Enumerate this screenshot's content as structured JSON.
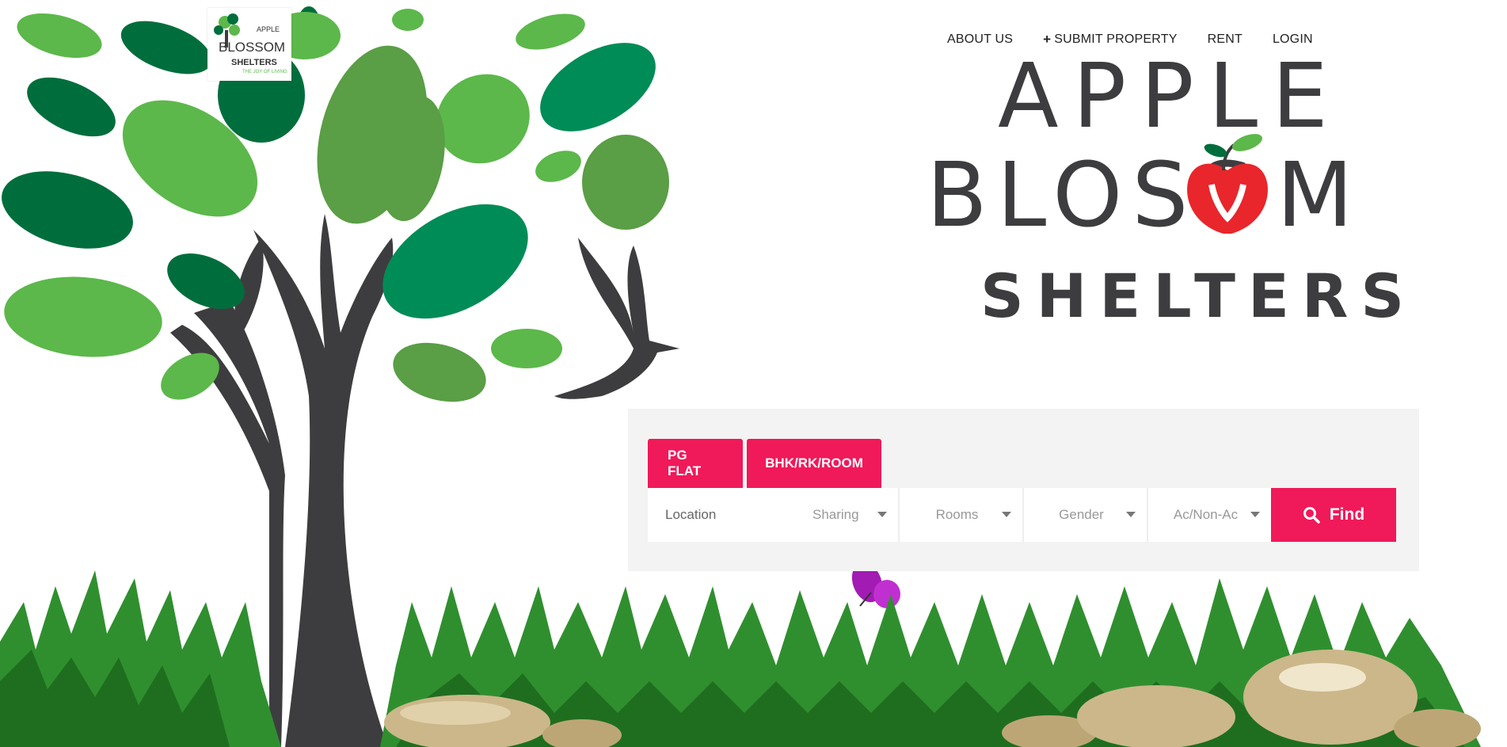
{
  "nav": {
    "items": [
      {
        "label": "ABOUT US"
      },
      {
        "label": "SUBMIT PROPERTY"
      },
      {
        "label": "RENT"
      },
      {
        "label": "LOGIN"
      }
    ]
  },
  "brand": {
    "line1": "APPLE",
    "line2_prefix": "BLOSS",
    "line2_suffix": "M",
    "line3": "SHELTERS"
  },
  "logo": {
    "line1": "APPLE",
    "line2": "BLOSSOM",
    "line3": "SHELTERS",
    "tagline": "THE JOY OF LIVING"
  },
  "search": {
    "tabs": [
      {
        "label": "PG FLAT"
      },
      {
        "label": "BHK/RK/ROOM"
      }
    ],
    "location_placeholder": "Location",
    "sharing": "Sharing",
    "rooms": "Rooms",
    "gender": "Gender",
    "ac": "Ac/Non-Ac",
    "find_label": "Find"
  },
  "colors": {
    "accent": "#f0195a",
    "leaf_dark": "#006e3c",
    "leaf_light": "#5cb84a",
    "trunk": "#3d3d3f",
    "apple_red": "#e8262b"
  }
}
